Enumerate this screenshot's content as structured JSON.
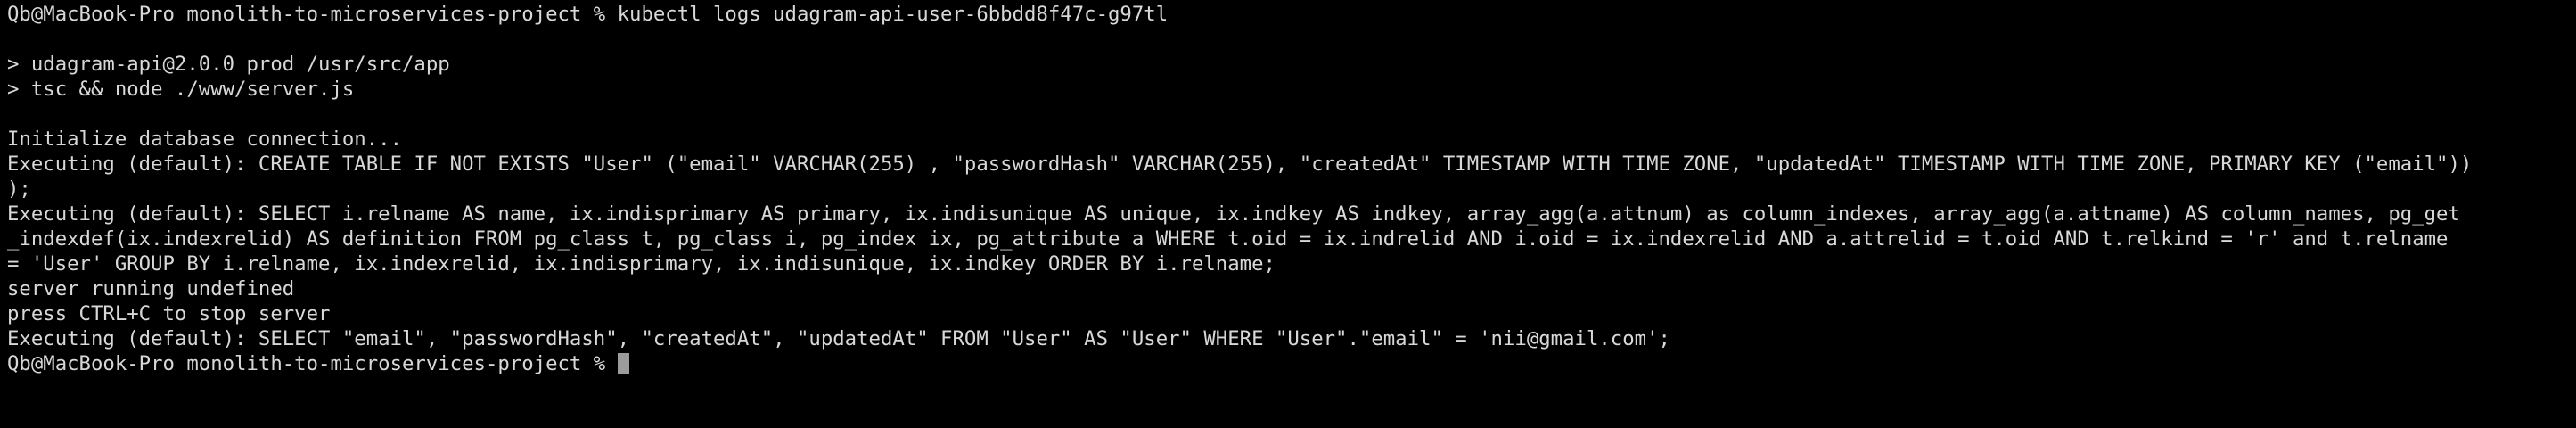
{
  "terminal": {
    "lines": [
      "Qb@MacBook-Pro monolith-to-microservices-project % kubectl logs udagram-api-user-6bbdd8f47c-g97tl",
      "",
      "> udagram-api@2.0.0 prod /usr/src/app",
      "> tsc && node ./www/server.js",
      "",
      "Initialize database connection...",
      "Executing (default): CREATE TABLE IF NOT EXISTS \"User\" (\"email\" VARCHAR(255) , \"passwordHash\" VARCHAR(255), \"createdAt\" TIMESTAMP WITH TIME ZONE, \"updatedAt\" TIMESTAMP WITH TIME ZONE, PRIMARY KEY (\"email\"))",
      ");",
      "Executing (default): SELECT i.relname AS name, ix.indisprimary AS primary, ix.indisunique AS unique, ix.indkey AS indkey, array_agg(a.attnum) as column_indexes, array_agg(a.attname) AS column_names, pg_get",
      "_indexdef(ix.indexrelid) AS definition FROM pg_class t, pg_class i, pg_index ix, pg_attribute a WHERE t.oid = ix.indrelid AND i.oid = ix.indexrelid AND a.attrelid = t.oid AND t.relkind = 'r' and t.relname",
      "= 'User' GROUP BY i.relname, ix.indexrelid, ix.indisprimary, ix.indisunique, ix.indkey ORDER BY i.relname;",
      "server running undefined",
      "press CTRL+C to stop server",
      "Executing (default): SELECT \"email\", \"passwordHash\", \"createdAt\", \"updatedAt\" FROM \"User\" AS \"User\" WHERE \"User\".\"email\" = 'nii@gmail.com';"
    ],
    "prompt": "Qb@MacBook-Pro monolith-to-microservices-project % ",
    "colors": {
      "background": "#000000",
      "text": "#d8d8d8",
      "cursor": "#9c9c9c"
    }
  }
}
